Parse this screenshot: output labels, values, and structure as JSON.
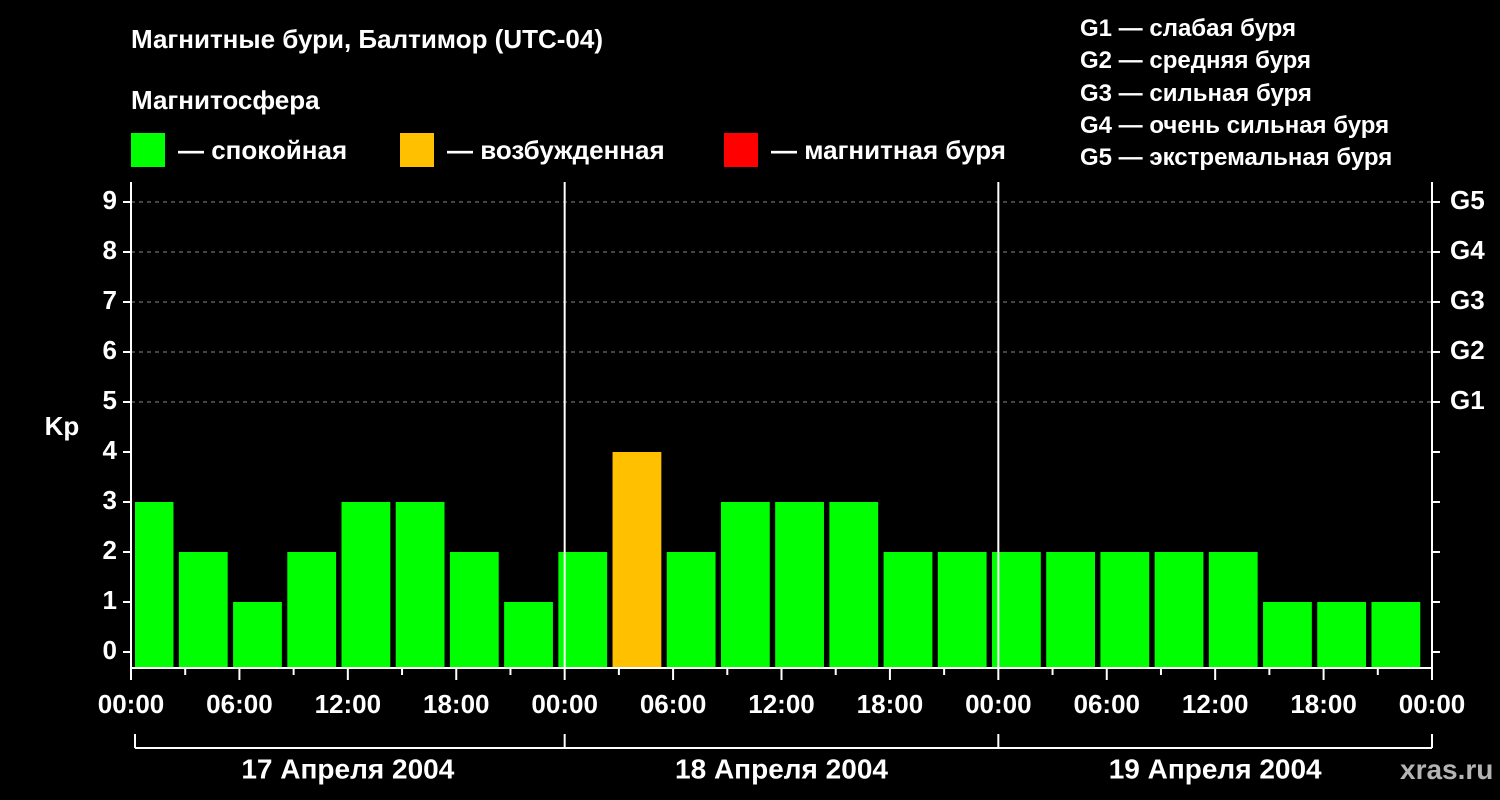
{
  "title": "Магнитные бури, Балтимор (UTC-04)",
  "legend": {
    "heading": "Магнитосфера",
    "items": [
      {
        "label": "— спокойная",
        "color": "#00ff00"
      },
      {
        "label": "— возбужденная",
        "color": "#ffc000"
      },
      {
        "label": "— магнитная буря",
        "color": "#ff0000"
      }
    ]
  },
  "g_scale": [
    "G1 — слабая буря",
    "G2 — средняя буря",
    "G3 — сильная буря",
    "G4 — очень сильная буря",
    "G5 — экстремальная буря"
  ],
  "watermark": "xras.ru",
  "chart_data": {
    "type": "bar",
    "ylabel": "Kp",
    "ylim": [
      0,
      9
    ],
    "y_ticks": [
      "0",
      "1",
      "2",
      "3",
      "4",
      "5",
      "6",
      "7",
      "8",
      "9"
    ],
    "right_ticks": [
      {
        "value": 5,
        "label": "G1"
      },
      {
        "value": 6,
        "label": "G2"
      },
      {
        "value": 7,
        "label": "G3"
      },
      {
        "value": 8,
        "label": "G4"
      },
      {
        "value": 9,
        "label": "G5"
      }
    ],
    "x_tick_labels": [
      "00:00",
      "06:00",
      "12:00",
      "18:00",
      "00:00",
      "06:00",
      "12:00",
      "18:00",
      "00:00",
      "06:00",
      "12:00",
      "18:00",
      "00:00"
    ],
    "days": [
      "17 Апреля 2004",
      "18 Апреля 2004",
      "19 Апреля 2004"
    ],
    "interval_hours": 3,
    "start_hour": 1,
    "values": [
      3,
      2,
      1,
      2,
      3,
      3,
      2,
      1,
      2,
      4,
      2,
      3,
      3,
      3,
      2,
      2,
      2,
      2,
      2,
      2,
      2,
      1,
      1,
      1
    ],
    "grid": "dashed lines at Kp 5–9",
    "colors": {
      "quiet": "#00ff00",
      "active": "#ffc000",
      "storm": "#ff0000"
    }
  }
}
